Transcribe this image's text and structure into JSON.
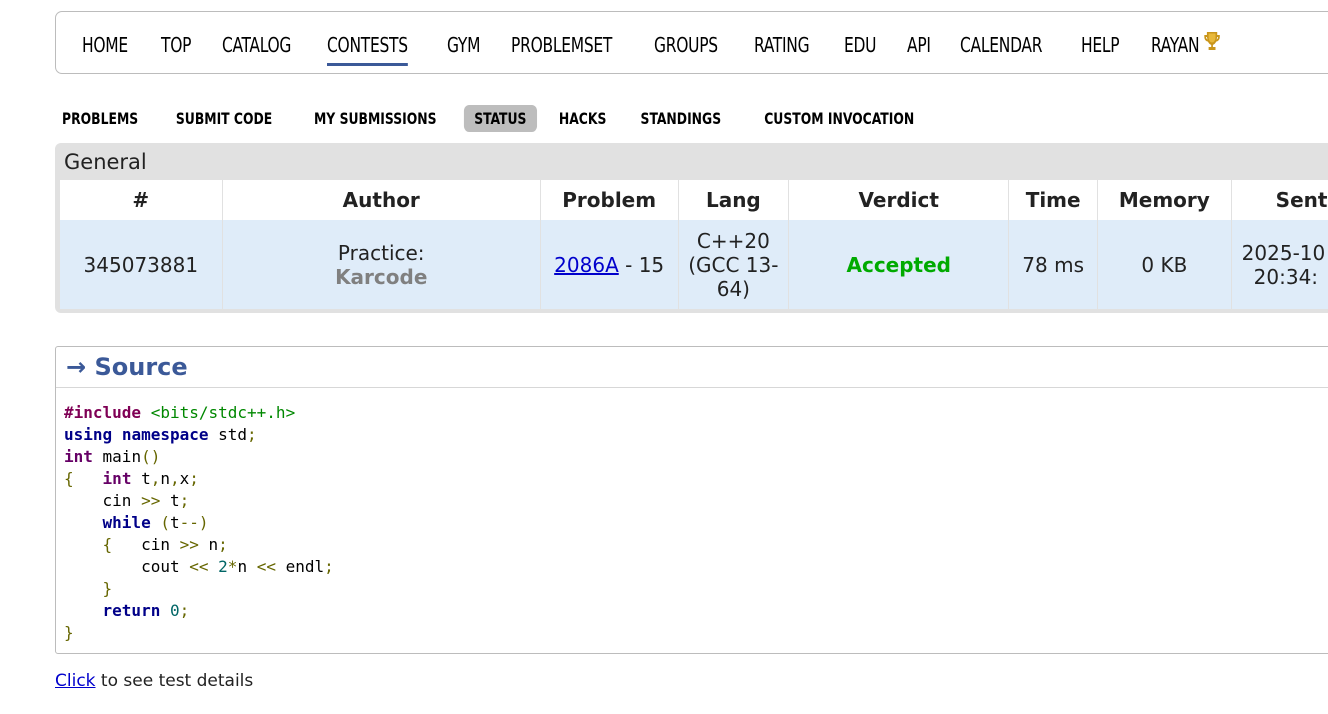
{
  "main_menu": {
    "items": [
      {
        "label": "HOME"
      },
      {
        "label": "TOP"
      },
      {
        "label": "CATALOG"
      },
      {
        "label": "CONTESTS"
      },
      {
        "label": "GYM"
      },
      {
        "label": "PROBLEMSET"
      },
      {
        "label": "GROUPS"
      },
      {
        "label": "RATING"
      },
      {
        "label": "EDU"
      },
      {
        "label": "API"
      },
      {
        "label": "CALENDAR"
      },
      {
        "label": "HELP"
      },
      {
        "label": "RAYAN"
      }
    ],
    "active": "CONTESTS",
    "trophy_icon": "trophy-icon"
  },
  "second_menu": {
    "items": [
      {
        "label": "PROBLEMS"
      },
      {
        "label": "SUBMIT CODE"
      },
      {
        "label": "MY SUBMISSIONS"
      },
      {
        "label": "STATUS"
      },
      {
        "label": "HACKS"
      },
      {
        "label": "STANDINGS"
      },
      {
        "label": "CUSTOM INVOCATION"
      }
    ],
    "active": "STATUS"
  },
  "general": {
    "title": "General",
    "headers": [
      "#",
      "Author",
      "Problem",
      "Lang",
      "Verdict",
      "Time",
      "Memory",
      "Sent"
    ],
    "row": {
      "id": "345073881",
      "author_prefix": "Practice:",
      "author_name": "Karcode",
      "problem_link": "2086A",
      "problem_suffix": " - 15",
      "lang_line1": "C++20",
      "lang_line2": "(GCC 13-",
      "lang_line3": "64)",
      "verdict": "Accepted",
      "time": "78 ms",
      "memory": "0 KB",
      "sent_line1": "2025-10",
      "sent_line2": "20:34:"
    }
  },
  "source": {
    "title": "→ Source",
    "code": [
      "#include <bits/stdc++.h>",
      "using namespace std;",
      "int main()",
      "{   int t,n,x;",
      "    cin >> t;",
      "    while (t--)",
      "    {   cin >> n;",
      "        cout << 2*n << endl;",
      "    }",
      "    return 0;",
      "}"
    ]
  },
  "test_details": {
    "link": "Click",
    "text": " to see test details"
  },
  "colors": {
    "accent": "#3b5998",
    "accepted": "#00aa00",
    "row_bg": "#dfecf9",
    "active_tab_bg": "#bdbdbd"
  }
}
